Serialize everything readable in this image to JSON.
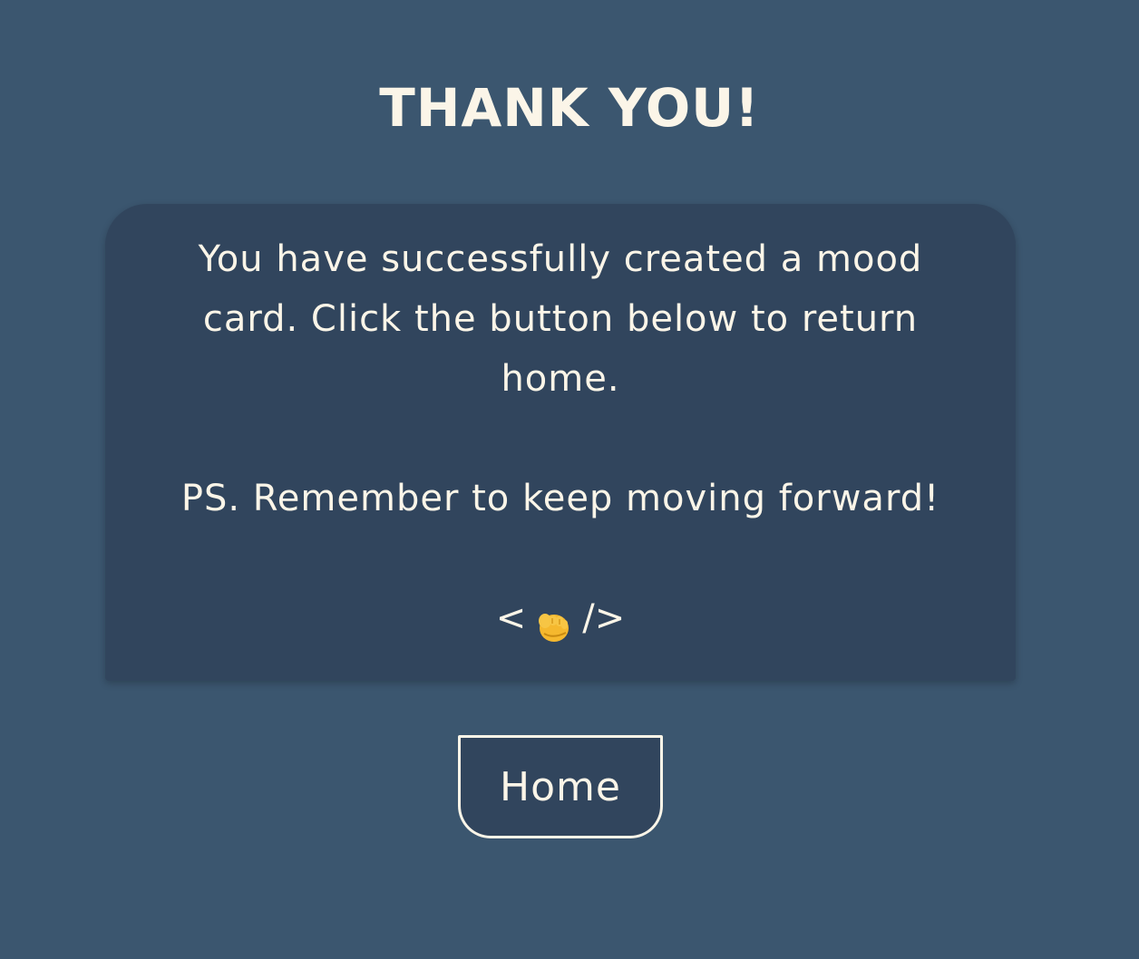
{
  "header": {
    "title": "THANK YOU!"
  },
  "card": {
    "message": "You have successfully created a mood card. Click the button below to return home.",
    "ps": "PS. Remember to keep moving forward!",
    "signature_left": "<",
    "signature_icon": "fist-emoji-icon",
    "signature_right": "/>"
  },
  "actions": {
    "home_label": "Home"
  },
  "colors": {
    "background": "#3b566f",
    "card": "#31455d",
    "text": "#fbf5e8"
  }
}
